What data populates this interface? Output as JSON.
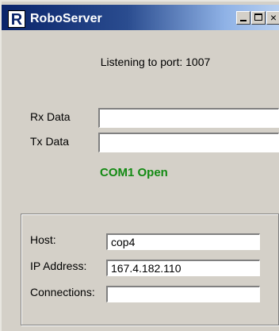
{
  "window": {
    "title": "RoboServer",
    "app_icon_glyph": "R",
    "buttons": {
      "minimize": "minimize-icon",
      "maximize": "maximize-icon",
      "close": "×"
    }
  },
  "server": {
    "listening_text": "Listening to port: 1007"
  },
  "serial": {
    "rx_label": "Rx Data",
    "rx_value": "",
    "tx_label": "Tx Data",
    "tx_value": "",
    "com_status": "COM1 Open",
    "com_status_color": "#138a13"
  },
  "connection": {
    "host_label": "Host:",
    "host_value": "cop4",
    "ip_label": "IP Address:",
    "ip_value": "167.4.182.110",
    "connections_label": "Connections:",
    "connections_value": ""
  },
  "colors": {
    "window_bg": "#d4d0c8",
    "titlebar_start": "#0a246a",
    "titlebar_end": "#b8d0f0"
  }
}
